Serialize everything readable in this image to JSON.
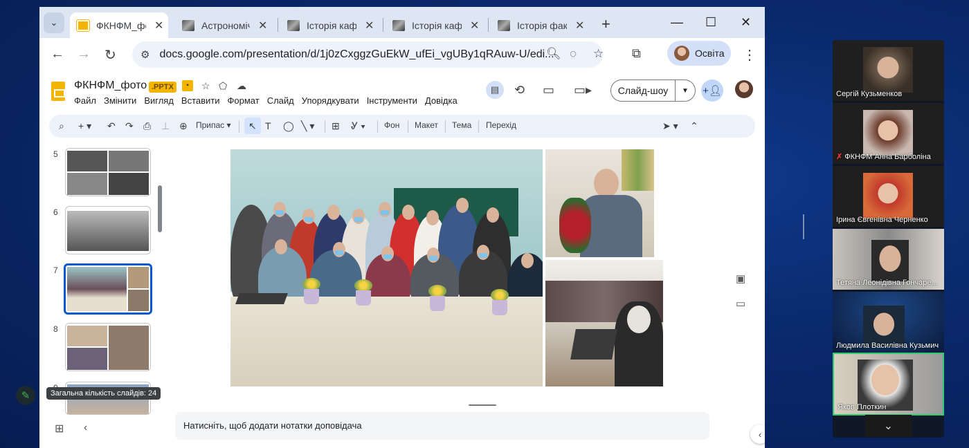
{
  "browser": {
    "tabs": [
      {
        "title": "ФКНФМ_фото",
        "active": true
      },
      {
        "title": "Астрономічна",
        "active": false
      },
      {
        "title": "Історія кафедри",
        "active": false
      },
      {
        "title": "Історія кафедри",
        "active": false
      },
      {
        "title": "Історія факультету",
        "active": false
      }
    ],
    "url": "docs.google.com/presentation/d/1j0zCxggzGuEkW_ufEi_vgUBy1qRAuw-U/edi...",
    "profile_label": "Освіта"
  },
  "slides": {
    "doc_title": "ФКНФМ_фото",
    "file_badge": ".PPTX",
    "menu": [
      "Файл",
      "Змінити",
      "Вигляд",
      "Вставити",
      "Формат",
      "Слайд",
      "Упорядкувати",
      "Інструменти",
      "Довідка"
    ],
    "slideshow_label": "Слайд-шоу",
    "toolbar": {
      "zoom_label": "Припас",
      "background": "Фон",
      "layout": "Макет",
      "theme": "Тема",
      "transition": "Перехід"
    },
    "thumbnails": [
      {
        "num": "5"
      },
      {
        "num": "6"
      },
      {
        "num": "7",
        "active": true
      },
      {
        "num": "8"
      },
      {
        "num": "9"
      }
    ],
    "slide_count_tooltip": "Загальна кількість слайдів: 24",
    "notes_placeholder": "Натисніть, щоб додати нотатки доповідача"
  },
  "meeting": {
    "participants": [
      {
        "name": "Сергій Кузьменков",
        "muted": false,
        "speaking": false
      },
      {
        "name": "ФКНФМ Анна Барболіна",
        "muted": true,
        "speaking": false
      },
      {
        "name": "Ірина Євгенівна Черненко",
        "muted": false,
        "speaking": false
      },
      {
        "name": "Тетяна Леонідівна Гончаре...",
        "muted": false,
        "speaking": false
      },
      {
        "name": "Людмила Василівна Кузьмич",
        "muted": false,
        "speaking": false
      },
      {
        "name": "Яков Плоткин",
        "muted": false,
        "speaking": true
      }
    ]
  },
  "colors": {
    "accent": "#0b57d0",
    "slides_yellow": "#f4b400",
    "speaking_border": "#2ecc71",
    "desktop_bg": "#0a2a6e"
  }
}
